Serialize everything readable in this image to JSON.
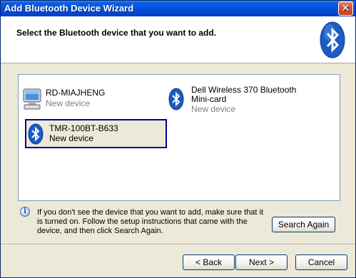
{
  "window": {
    "title": "Add Bluetooth Device Wizard",
    "close_label": "✕"
  },
  "header": {
    "instruction": "Select the Bluetooth device that you want to add."
  },
  "devices": [
    {
      "name": "RD-MIAJHENG",
      "status": "New device",
      "icon": "computer-icon",
      "selected": false
    },
    {
      "name": "Dell Wireless 370 Bluetooth Mini-card",
      "status": "New device",
      "icon": "bluetooth-icon",
      "selected": false
    },
    {
      "name": "TMR-100BT-B633",
      "status": "New device",
      "icon": "bluetooth-icon",
      "selected": true
    }
  ],
  "info": {
    "icon": "info-icon",
    "text": "If you don't see the device that you want to add, make sure that it is turned on. Follow the setup instructions that came with the device, and then click Search Again."
  },
  "buttons": {
    "search_again": "Search Again",
    "back": "< Back",
    "next": "Next >",
    "cancel": "Cancel"
  },
  "colors": {
    "titlebar": "#0552dc",
    "selection_border": "#00009c",
    "bluetooth_blue": "#1a5bc4"
  }
}
